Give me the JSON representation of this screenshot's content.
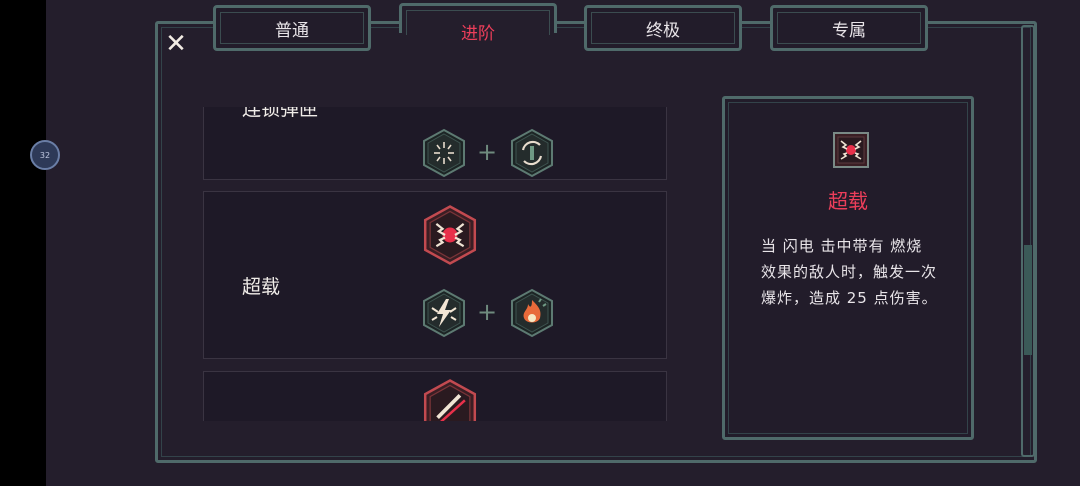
{
  "tabs": [
    {
      "label": "普通"
    },
    {
      "label": "进阶"
    },
    {
      "label": "终极"
    },
    {
      "label": "专属"
    }
  ],
  "active_tab": "进阶",
  "side_bubble": "32",
  "list": [
    {
      "name": "连锁弹匣",
      "icons": [
        "radial-burst-icon",
        "cycle-arrow-icon"
      ]
    },
    {
      "name": "超载",
      "result_icon": "overload-icon",
      "icons": [
        "lightning-icon",
        "fire-icon"
      ]
    },
    {
      "name": "",
      "result_icon": "slash-icon"
    }
  ],
  "detail": {
    "icon": "overload-icon",
    "title": "超载",
    "description": "当 闪电 击中带有 燃烧 效果的敌人时，触发一次 爆炸，造成 25 点伤害。"
  },
  "colors": {
    "accent": "#ec3e5a",
    "frame": "#4f6a6a",
    "background": "#241e2c"
  }
}
